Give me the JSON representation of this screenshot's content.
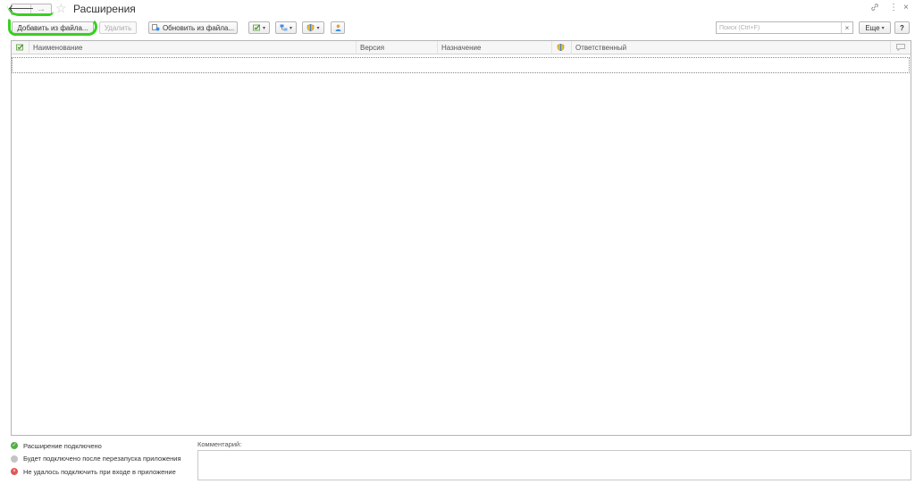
{
  "window": {
    "title": "Расширения",
    "back_glyph": "🡐",
    "forward_glyph": "→",
    "favorite_glyph": "☆",
    "link_glyph": "🔗",
    "menu_glyph": "⋮",
    "close_glyph": "×"
  },
  "toolbar": {
    "add_from_file": "Добавить из файла...",
    "delete": "Удалить",
    "update_from_file": "Обновить из файла...",
    "more": "Еще",
    "help": "?",
    "search_placeholder": "Поиск (Ctrl+F)",
    "search_clear": "×",
    "caret": "▾"
  },
  "table": {
    "columns": [
      "Наименование",
      "Версия",
      "Назначение",
      "Ответственный"
    ]
  },
  "legend": [
    {
      "text": "Расширение подключено",
      "status": "green",
      "mark": "✓"
    },
    {
      "text": "Будет подключено после перезапуска приложения",
      "status": "gray",
      "mark": ""
    },
    {
      "text": "Не удалось подключить при входе в приложение",
      "status": "red",
      "mark": "×"
    }
  ],
  "comment": {
    "label": "Комментарий:",
    "value": ""
  },
  "colors": {
    "highlight": "#37d01f",
    "ok": "#52b043",
    "error": "#e25757"
  }
}
